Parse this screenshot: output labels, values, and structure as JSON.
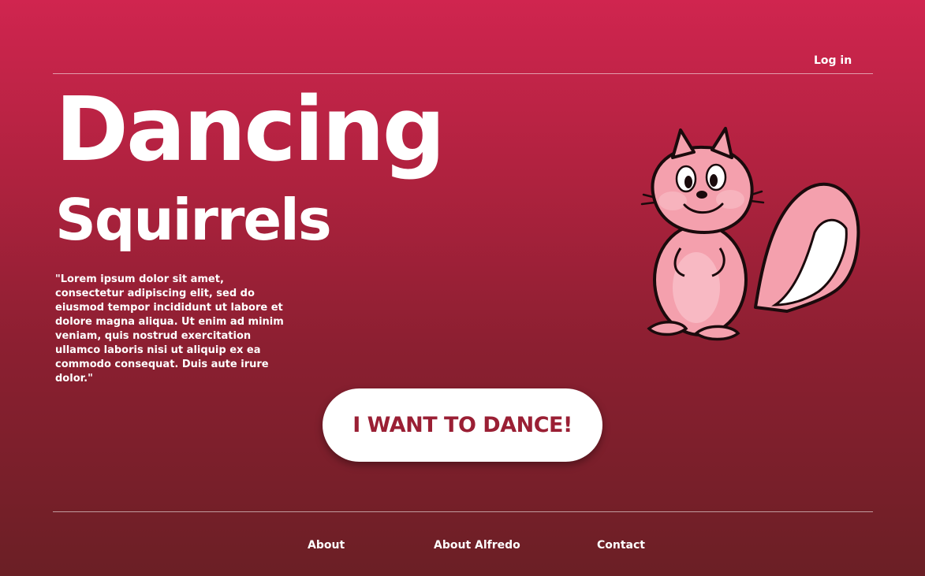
{
  "header": {
    "login_label": "Log in"
  },
  "hero": {
    "title_line1": "Dancing",
    "title_line2": "Squirrels",
    "quote": "\"Lorem ipsum dolor sit amet, consectetur adipiscing elit, sed do eiusmod tempor incididunt ut labore et dolore magna aliqua. Ut enim ad minim veniam, quis nostrud exercitation ullamco laboris nisi ut aliquip ex ea commodo consequat. Duis aute irure dolor.\"",
    "cta_label": "I WANT TO DANCE!",
    "illustration": "squirrel-illustration"
  },
  "footer": {
    "links": [
      {
        "label": "About"
      },
      {
        "label": "About Alfredo"
      },
      {
        "label": "Contact"
      }
    ]
  },
  "colors": {
    "background_top": "#d0254f",
    "background_bottom": "#6b1f25",
    "cta_text": "#9a1f34",
    "squirrel_pink": "#f4a0ad"
  }
}
